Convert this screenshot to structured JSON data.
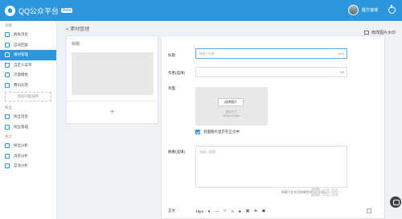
{
  "topbar": {
    "brand": "QQ公众平台",
    "beta": "Beta",
    "user": "醒华速瑞"
  },
  "sidebar": {
    "sections": [
      {
        "title": "功能",
        "items": [
          {
            "label": "群发消息",
            "active": false
          },
          {
            "label": "自动回复",
            "active": false
          },
          {
            "label": "素材管理",
            "active": true
          },
          {
            "label": "自定义菜单",
            "active": false
          },
          {
            "label": "页面模板",
            "active": false
          },
          {
            "label": "腾讯问卷",
            "active": false
          }
        ],
        "add_label": "添加功能插件"
      },
      {
        "title": "粉丝",
        "items": [
          {
            "label": "粉丝消息",
            "active": false
          },
          {
            "label": "粉丝管理",
            "active": false
          }
        ]
      },
      {
        "title": "统计",
        "items": [
          {
            "label": "粉丝分析",
            "active": false
          },
          {
            "label": "消息分析",
            "active": false
          },
          {
            "label": "互动分析",
            "active": false
          }
        ]
      }
    ]
  },
  "breadcrumb": "素材管理",
  "top_link": "修改图片水印",
  "left_panel": {
    "label": "标题",
    "add": "+"
  },
  "form": {
    "title": {
      "label": "标题",
      "placeholder": "请输入标题",
      "count": "0/64"
    },
    "author": {
      "label": "作者(选填)",
      "count": "0/8"
    },
    "cover": {
      "label": "封面",
      "button": "选择图片",
      "tip_line1": "建议尺寸:",
      "tip_line2": "900px×500px"
    },
    "cover_in_body": {
      "label": "封面图片显示在正文中",
      "checked": true
    },
    "summary": {
      "label": "摘要(选填)",
      "placeholder": "请输入摘要"
    },
    "hint": "摘要只在发送纯单图文消息时显示",
    "body": {
      "label": "正文",
      "font_size": "18px",
      "toolbar": [
        "♥",
        "—",
        "⊂",
        "A",
        "♣",
        "▦",
        "⊕",
        "▣"
      ]
    }
  },
  "watermark": "经验",
  "colors": {
    "primary": "#2c97de",
    "sidebar_bg": "#ffffff",
    "page_bg": "#eef1f5"
  },
  "icons": [
    "logo-icon",
    "avatar",
    "power-icon",
    "chat-icon"
  ]
}
